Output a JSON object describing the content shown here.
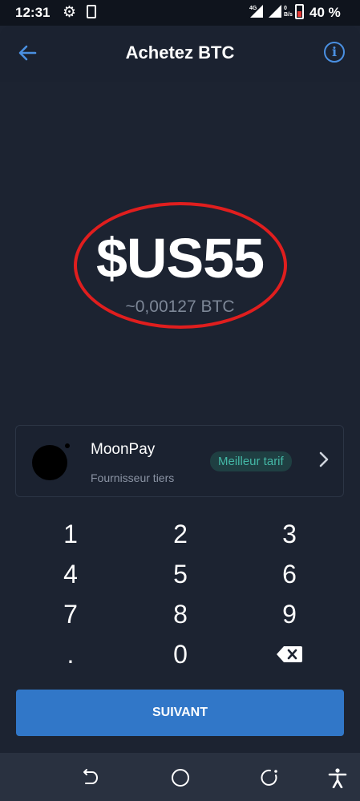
{
  "status": {
    "time": "12:31",
    "network_label": "4G",
    "data_rate": "0\nB/s",
    "battery": "40 %"
  },
  "header": {
    "title": "Achetez BTC",
    "back_icon": "arrow-left-icon",
    "info_icon": "info-icon",
    "info_glyph": "i"
  },
  "amount": {
    "value": "$US55",
    "btc_estimate": "~0,00127 BTC",
    "highlight_color": "#e01e1e"
  },
  "provider": {
    "name": "MoonPay",
    "subtitle": "Fournisseur tiers",
    "badge": "Meilleur tarif",
    "chevron": "›"
  },
  "keypad": {
    "keys": [
      "1",
      "2",
      "3",
      "4",
      "5",
      "6",
      "7",
      "8",
      "9",
      ".",
      "0"
    ],
    "backspace_icon": "backspace-icon"
  },
  "next_button": {
    "label": "SUIVANT"
  },
  "nav": [
    "back-nav-icon",
    "home-nav-icon",
    "recents-nav-icon",
    "accessibility-icon"
  ],
  "colors": {
    "background": "#1c2331",
    "accent": "#4a90e2",
    "primary_button": "#3177c8",
    "badge_text": "#44b8a6"
  }
}
